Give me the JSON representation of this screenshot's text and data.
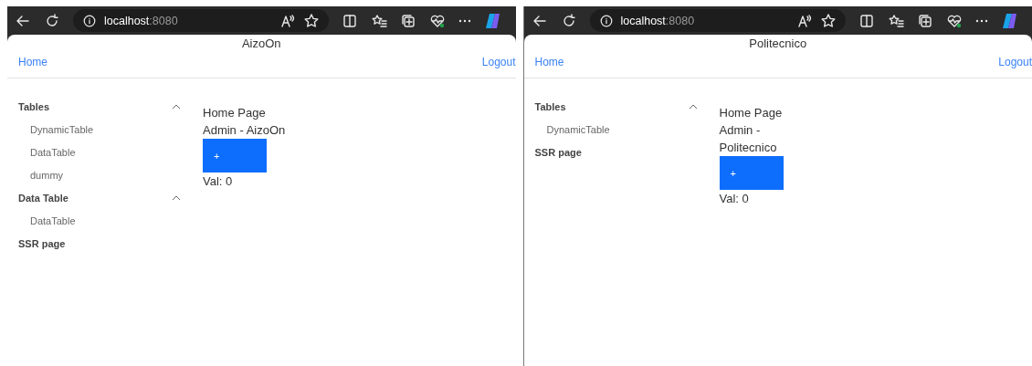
{
  "windows": [
    {
      "address": {
        "host": "localhost",
        "port": ":8080"
      },
      "header": {
        "home": "Home",
        "title": "AizoOn",
        "logout": "Logout"
      },
      "sidebar": [
        {
          "kind": "group",
          "label": "Tables",
          "expanded": true,
          "children": [
            {
              "label": "DynamicTable"
            },
            {
              "label": "DataTable"
            },
            {
              "label": "dummy"
            }
          ]
        },
        {
          "kind": "group",
          "label": "Data Table",
          "expanded": true,
          "children": [
            {
              "label": "DataTable"
            }
          ]
        },
        {
          "kind": "link",
          "label": "SSR page"
        }
      ],
      "content": {
        "heading": "Home Page",
        "subtitle": "Admin - AizoOn",
        "button": "+",
        "value": "Val: 0"
      }
    },
    {
      "address": {
        "host": "localhost",
        "port": ":8080"
      },
      "header": {
        "home": "Home",
        "title": "Politecnico",
        "logout": "Logout"
      },
      "sidebar": [
        {
          "kind": "group",
          "label": "Tables",
          "expanded": true,
          "children": [
            {
              "label": "DynamicTable"
            }
          ]
        },
        {
          "kind": "link",
          "label": "SSR page"
        }
      ],
      "content": {
        "heading": "Home Page",
        "subtitle": "Admin - Politecnico",
        "button": "+",
        "value": "Val: 0"
      }
    }
  ]
}
